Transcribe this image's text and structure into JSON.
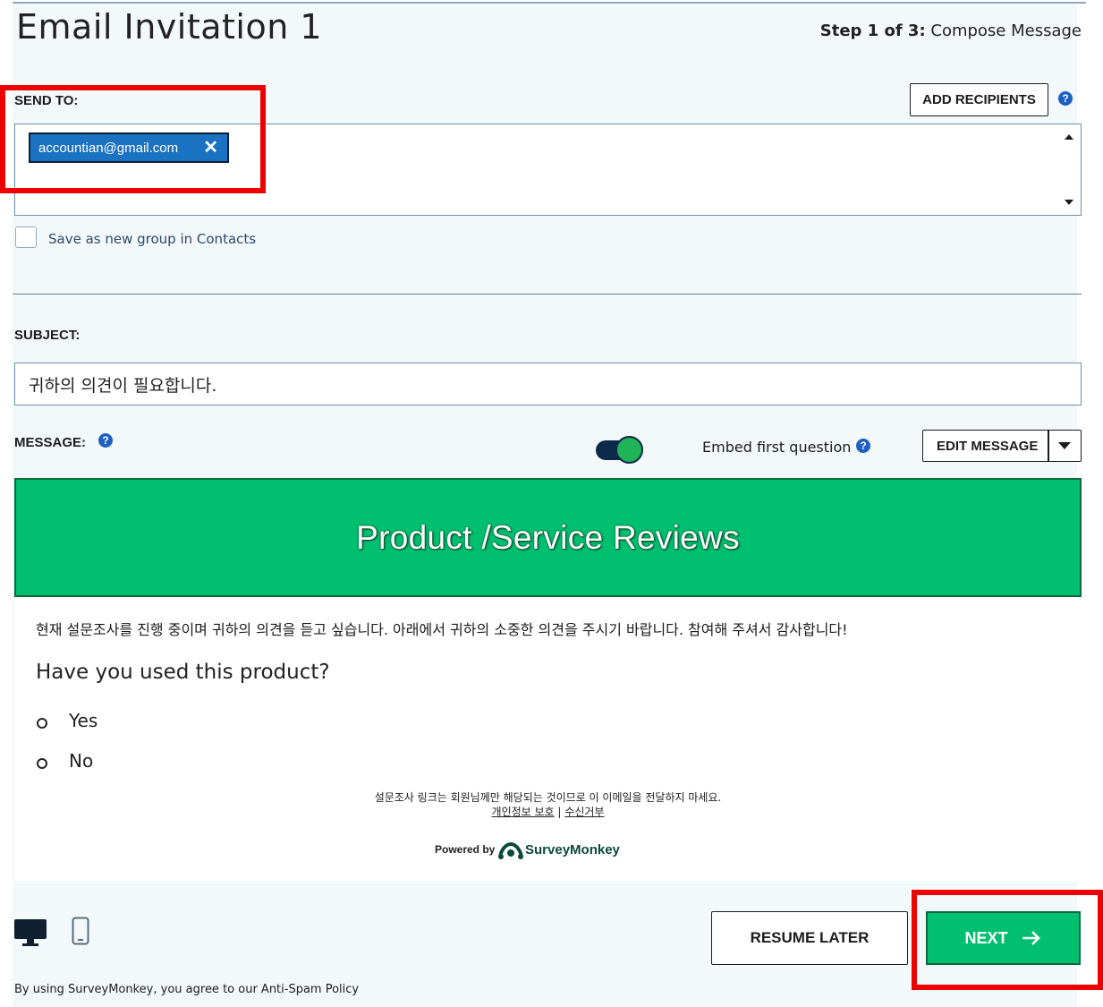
{
  "header": {
    "title": "Email Invitation 1",
    "step_bold": "Step 1 of 3:",
    "step_rest": " Compose Message"
  },
  "send_to": {
    "label": "SEND TO:",
    "add_recipients_label": "ADD RECIPIENTS",
    "recipients": [
      "accountian@gmail.com"
    ],
    "save_group_label": "Save as new group in Contacts",
    "save_group_checked": false
  },
  "subject": {
    "label": "SUBJECT:",
    "value": "귀하의 의견이 필요합니다."
  },
  "message": {
    "label": "MESSAGE:",
    "embed_label": "Embed first question",
    "embed_enabled": true,
    "edit_message_label": "EDIT MESSAGE"
  },
  "preview": {
    "banner_title": "Product /Service Reviews",
    "intro": "현재 설문조사를 진행 중이며 귀하의 의견을 듣고 싶습니다. 아래에서 귀하의 소중한 의견을 주시기 바랍니다. 참여해 주셔서 감사합니다!",
    "question": "Have you used this product?",
    "options": [
      "Yes",
      "No"
    ],
    "footer_note": "설문조사 링크는 회원님께만 해당되는 것이므로 이 이메일을 전달하지 마세요.",
    "privacy_link": "개인정보 보호",
    "separator": " | ",
    "unsubscribe_link": "수신거부",
    "powered_by": "Powered by",
    "brand": "SurveyMonkey"
  },
  "footer": {
    "resume_later_label": "RESUME LATER",
    "next_label": "NEXT",
    "legal_text": "By using SurveyMonkey, you agree to our Anti-Spam Policy"
  },
  "colors": {
    "brand_green": "#00bf6f",
    "chip_blue": "#1b72c2",
    "help_blue": "#1e5fc2",
    "highlight_red": "#ef0000"
  },
  "icons": [
    "remove-recipient-icon",
    "help-icon",
    "scroll-up-icon",
    "scroll-down-icon",
    "dropdown-caret-icon",
    "desktop-view-icon",
    "mobile-view-icon",
    "surveymonkey-logo-icon",
    "arrow-right-icon"
  ]
}
